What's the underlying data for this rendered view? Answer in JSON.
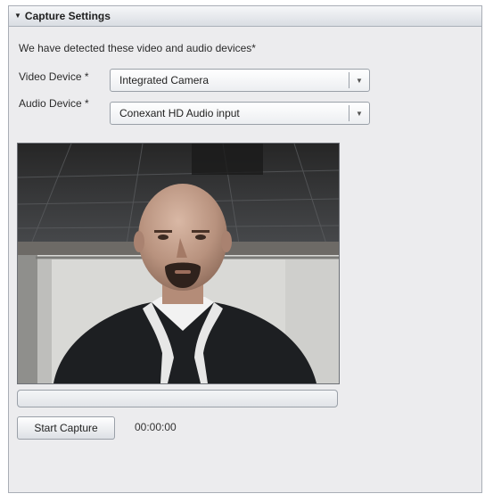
{
  "panel": {
    "title": "Capture Settings",
    "collapse_icon": "triangle-down-icon"
  },
  "intro_text": "We have detected these video and audio devices*",
  "video_device": {
    "label": "Video Device *",
    "selected": "Integrated Camera"
  },
  "audio_device": {
    "label": "Audio Device *",
    "selected": "Conexant HD Audio input"
  },
  "progress": {
    "value": 0
  },
  "capture": {
    "start_label": "Start Capture",
    "timer": "00:00:00"
  }
}
